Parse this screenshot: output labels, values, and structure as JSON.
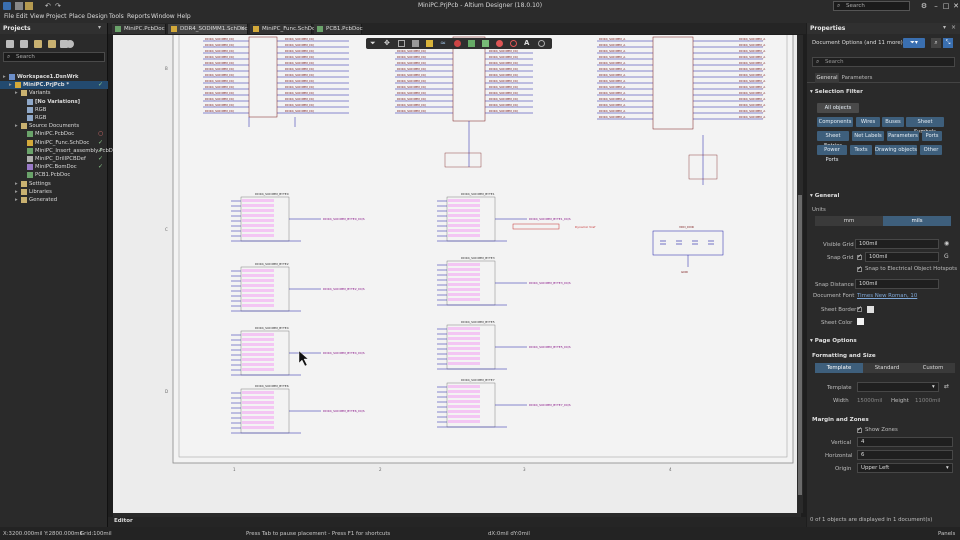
{
  "window": {
    "title": "MiniPC.PrjPcb - Altium Designer (18.0.10)",
    "search_placeholder": "Search"
  },
  "menu": [
    "File",
    "Edit",
    "View",
    "Project",
    "Place",
    "Design",
    "Tools",
    "Reports",
    "Window",
    "Help"
  ],
  "projects_panel": {
    "title": "Projects",
    "search_placeholder": "Search",
    "tree": [
      {
        "label": "Workspace1.DsnWrk",
        "indent": 0,
        "icon": "workspace-icon",
        "mark": "",
        "bold": true
      },
      {
        "label": "MiniPC.PrjPcb *",
        "indent": 1,
        "icon": "project-icon",
        "mark": "✓",
        "bold": true,
        "selected": true
      },
      {
        "label": "Variants",
        "indent": 2,
        "icon": "folder-icon",
        "mark": ""
      },
      {
        "label": "[No Variations]",
        "indent": 3,
        "icon": "variant-icon",
        "mark": "",
        "bold": true
      },
      {
        "label": "RGB",
        "indent": 3,
        "icon": "variant-icon",
        "mark": ""
      },
      {
        "label": "RGB",
        "indent": 3,
        "icon": "variant-icon",
        "mark": ""
      },
      {
        "label": "Source Documents",
        "indent": 2,
        "icon": "folder-icon",
        "mark": ""
      },
      {
        "label": "MiniPC.PcbDoc",
        "indent": 3,
        "icon": "pcb-doc-icon",
        "mark": "○"
      },
      {
        "label": "MiniPC_Func.SchDoc",
        "indent": 3,
        "icon": "sch-doc-icon",
        "mark": "✓"
      },
      {
        "label": "MiniPC_Insert_assembly.PcbDoc",
        "indent": 3,
        "icon": "pcb-doc-icon",
        "mark": "✓"
      },
      {
        "label": "MiniPC_DrillPCBDef",
        "indent": 3,
        "icon": "doc-icon",
        "mark": "✓"
      },
      {
        "label": "MiniPC.BomDoc",
        "indent": 3,
        "icon": "bom-doc-icon",
        "mark": "✓"
      },
      {
        "label": "PCB1.PcbDoc",
        "indent": 3,
        "icon": "pcb-doc-icon",
        "mark": ""
      },
      {
        "label": "Settings",
        "indent": 2,
        "icon": "folder-icon",
        "mark": ""
      },
      {
        "label": "Libraries",
        "indent": 2,
        "icon": "folder-icon",
        "mark": ""
      },
      {
        "label": "Generated",
        "indent": 2,
        "icon": "folder-icon",
        "mark": ""
      }
    ]
  },
  "doc_tabs": [
    {
      "label": "MiniPC.PcbDoc",
      "active": false,
      "icon": "pcb-doc-icon"
    },
    {
      "label": "DDR4_SODIMM1.SchDoc",
      "active": true,
      "icon": "sch-doc-icon"
    },
    {
      "label": "MiniPC_Func.SchDoc",
      "active": false,
      "icon": "sch-doc-icon"
    },
    {
      "label": "PCB1.PcbDoc",
      "active": false,
      "icon": "pcb-doc-icon"
    }
  ],
  "editor_tab": "Editor",
  "schematic": {
    "row_markers": [
      "B",
      "C",
      "D"
    ],
    "col_markers": [
      "1",
      "2",
      "3",
      "4"
    ],
    "top_left_label": "DDR4_SODIMM_DQ",
    "top_mid_label": "DDR4_SODIMM_DQ",
    "top_right_label": "DDR4_SODIMM_A",
    "byte_blocks_left": [
      "DDR4_SODIMM_BYTE0",
      "DDR4_SODIMM_BYTE2",
      "DDR4_SODIMM_BYTE4",
      "DDR4_SODIMM_BYTE6"
    ],
    "byte_blocks_right": [
      "DDR4_SODIMM_BYTE1",
      "DDR4_SODIMM_BYTE3",
      "DDR4_SODIMM_BYTE5",
      "DDR4_SODIMM_BYTE7"
    ],
    "net_labels_left": [
      "DDR4_SODIMM_BYTE0_DQS",
      "DDR4_SODIMM_BYTE2_DQS",
      "DDR4_SODIMM_BYTE4_DQS",
      "DDR4_SODIMM_BYTE6_DQS"
    ],
    "net_labels_right": [
      "DDR4_SODIMM_BYTE1_DQS",
      "DDR4_SODIMM_BYTE3_DQS",
      "DDR4_SODIMM_BYTE5_DQS",
      "DDR4_SODIMM_BYTE7_DQS"
    ],
    "cap_block_label": "VDD_DDR",
    "dynamic_vref": "Dynamic Vref",
    "vdd_label": "VDD_DDR",
    "gnd_label": "GND"
  },
  "properties_panel": {
    "title": "Properties",
    "filter_label": "Document Options",
    "filter_sub": "(and 11 more)",
    "search_placeholder": "Search",
    "tabs": [
      "General",
      "Parameters"
    ],
    "selection_filter": {
      "heading": "Selection Filter",
      "all_objects": "All objects",
      "buttons": [
        "Components",
        "Wires",
        "Buses",
        "Sheet Symbols",
        "Sheet Entries",
        "Net Labels",
        "Parameters",
        "Ports",
        "Power Ports",
        "Texts",
        "Drawing objects",
        "Other"
      ]
    },
    "general": {
      "heading": "General",
      "units_label": "Units",
      "units": [
        "mm",
        "mils"
      ],
      "visible_grid_label": "Visible Grid",
      "visible_grid": "100mil",
      "snap_grid_label": "Snap Grid",
      "snap_grid": "100mil",
      "snap_electrical": "Snap to Electrical Object Hotspots",
      "snap_distance_label": "Snap Distance",
      "snap_distance": "100mil",
      "document_font_label": "Document Font",
      "document_font": "Times New Roman, 10",
      "sheet_border_label": "Sheet Border",
      "sheet_color_label": "Sheet Color"
    },
    "page_options": {
      "heading": "Page Options",
      "formatting_heading": "Formatting and Size",
      "formats": [
        "Template",
        "Standard",
        "Custom"
      ],
      "template_label": "Template",
      "width_label": "Width",
      "width": "15000mil",
      "height_label": "Height",
      "height": "11000mil",
      "margin_heading": "Margin and Zones",
      "show_zones": "Show Zones",
      "vertical_label": "Vertical",
      "vertical": "4",
      "horizontal_label": "Horizontal",
      "horizontal": "6",
      "origin_label": "Origin",
      "origin": "Upper Left"
    },
    "footer": "0 of 1 objects are displayed in 1 document(s)"
  },
  "status": {
    "coords": "X:3200.000mil Y:2800.000mil",
    "grid": "Grid:100mil",
    "hint": "Press Tab to pause placement - Press F1 for shortcuts",
    "delta": "dX:0mil dY:0mil",
    "panels": "Panels"
  },
  "colors": {
    "accent": "#2f78c4",
    "schematic_wire": "#1a1aa6",
    "schematic_text": "#7a1a1a",
    "net_label": "#8a1a8a",
    "sheet_bg": "#ececec"
  }
}
